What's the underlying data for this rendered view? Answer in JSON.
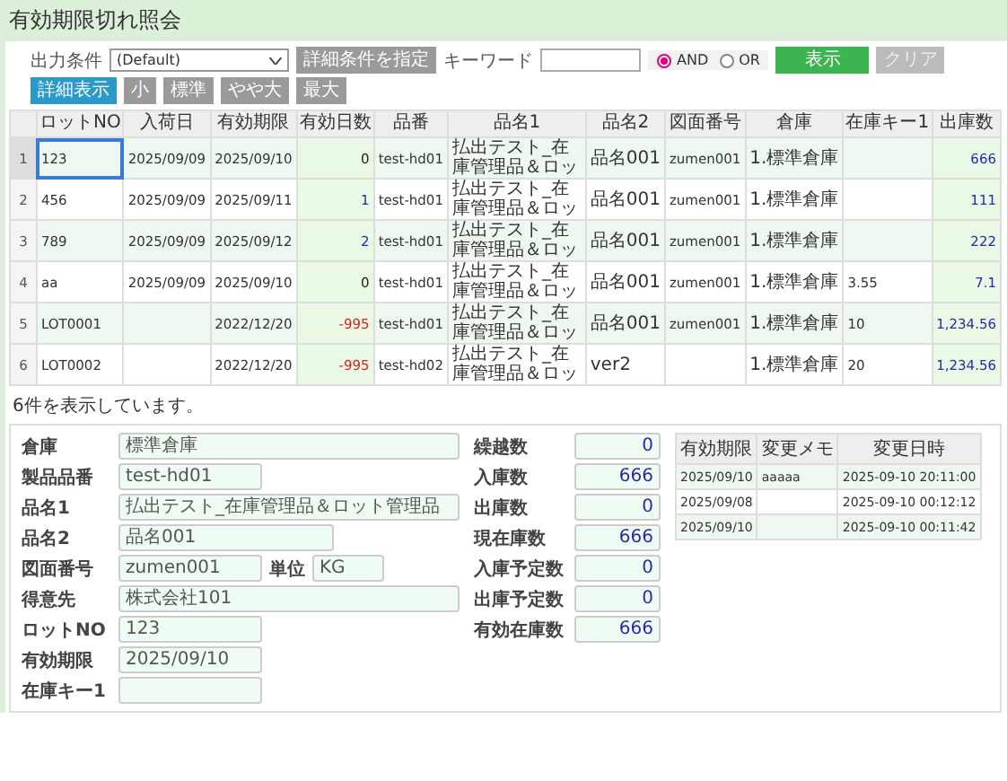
{
  "title": "有効期限切れ照会",
  "toolbar": {
    "output_condition": {
      "label": "出力条件",
      "value": "(Default)"
    },
    "condition_button": "詳細条件を指定",
    "keyword": {
      "label": "キーワード"
    },
    "radios": [
      {
        "label": "AND",
        "selected": true
      },
      {
        "label": "OR",
        "selected": false
      }
    ],
    "buttons": [
      {
        "label": "表示",
        "kind": "primary"
      },
      {
        "label": "クリア",
        "kind": "disabled"
      },
      {
        "label": "詳細表示",
        "kind": "info"
      },
      {
        "label": "小",
        "kind": "size"
      },
      {
        "label": "標準",
        "kind": "size"
      },
      {
        "label": "やや大",
        "kind": "size"
      },
      {
        "label": "最大",
        "kind": "size"
      }
    ]
  },
  "grid": {
    "columns": [
      {
        "label": "ロットNO",
        "kind": "text"
      },
      {
        "label": "入荷日",
        "kind": "text"
      },
      {
        "label": "有効期限",
        "kind": "text"
      },
      {
        "label": "有効日数",
        "kind": "days"
      },
      {
        "label": "品番",
        "kind": "text"
      },
      {
        "label": "品名1",
        "kind": "text"
      },
      {
        "label": "品名2",
        "kind": "text"
      },
      {
        "label": "図面番号",
        "kind": "text"
      },
      {
        "label": "倉庫",
        "kind": "text"
      },
      {
        "label": "在庫キー1",
        "kind": "text"
      },
      {
        "label": "出庫数",
        "kind": "number"
      }
    ],
    "rows": [
      {
        "row_number": "1",
        "selected": true,
        "color": "#222222",
        "cells": [
          "123",
          "2025/09/09",
          "2025/09/10",
          "0",
          "test-hd01",
          "払出テスト_在庫管理品＆ロッ",
          "品名001",
          "zumen001",
          "1.標準倉庫",
          "",
          "666"
        ]
      },
      {
        "row_number": "2",
        "selected": false,
        "color": "#2a2aa8",
        "cells": [
          "456",
          "2025/09/09",
          "2025/09/11",
          "1",
          "test-hd01",
          "払出テスト_在庫管理品＆ロッ",
          "品名001",
          "zumen001",
          "1.標準倉庫",
          "",
          "111"
        ]
      },
      {
        "row_number": "3",
        "selected": false,
        "color": "#2a2aa8",
        "cells": [
          "789",
          "2025/09/09",
          "2025/09/12",
          "2",
          "test-hd01",
          "払出テスト_在庫管理品＆ロッ",
          "品名001",
          "zumen001",
          "1.標準倉庫",
          "",
          "222"
        ]
      },
      {
        "row_number": "4",
        "selected": false,
        "color": "#222222",
        "cells": [
          "aa",
          "2025/09/09",
          "2025/09/10",
          "0",
          "test-hd01",
          "払出テスト_在庫管理品＆ロッ",
          "品名001",
          "zumen001",
          "1.標準倉庫",
          "3.55",
          "7.1"
        ]
      },
      {
        "row_number": "5",
        "selected": false,
        "color": "#e02020",
        "cells": [
          "LOT0001",
          "",
          "2022/12/20",
          "-995",
          "test-hd01",
          "払出テスト_在庫管理品＆ロッ",
          "品名001",
          "zumen001",
          "1.標準倉庫",
          "10",
          "1,234.56"
        ]
      },
      {
        "row_number": "6",
        "selected": false,
        "color": "#e02020",
        "cells": [
          "LOT0002",
          "",
          "2022/12/20",
          "-995",
          "test-hd02",
          "払出テスト_在庫管理品＆ロッ",
          "ver2",
          "",
          "1.標準倉庫",
          "20",
          "1,234.56"
        ]
      }
    ]
  },
  "status": "6件を表示しています。",
  "detail": {
    "fields": [
      {
        "label": "倉庫",
        "value": "標準倉庫",
        "kind": "long"
      },
      {
        "label": "製品品番",
        "value": "test-hd01",
        "kind": "short"
      },
      {
        "label": "品名1",
        "value": "払出テスト_在庫管理品＆ロット管理品",
        "kind": "long"
      },
      {
        "label": "品名2",
        "value": "品名001",
        "kind": "medium"
      },
      {
        "label": "図面番号",
        "value": "zumen001",
        "kind": "short",
        "unit": {
          "label": "単位",
          "value": "KG"
        }
      },
      {
        "label": "得意先",
        "value": "株式会社101",
        "kind": "long"
      },
      {
        "label": "ロットNO",
        "value": "123",
        "kind": "short"
      },
      {
        "label": "有効期限",
        "value": "2025/09/10",
        "kind": "short"
      },
      {
        "label": "在庫キー1",
        "kind": "short"
      }
    ],
    "totals": [
      {
        "label": "繰越数",
        "value": "0"
      },
      {
        "label": "入庫数",
        "value": "666"
      },
      {
        "label": "出庫数",
        "value": "0"
      },
      {
        "label": "現在庫数",
        "value": "666"
      },
      {
        "label": "入庫予定数",
        "value": "0"
      },
      {
        "label": "出庫予定数",
        "value": "0"
      },
      {
        "label": "有効在庫数",
        "value": "666"
      }
    ],
    "history": {
      "columns": [
        "有効期限",
        "変更メモ",
        "変更日時"
      ],
      "rows": [
        {
          "expiry": "2025/09/10",
          "memo": "aaaaa",
          "changed_at": "2025-09-10 20:11:00"
        },
        {
          "expiry": "2025/09/08",
          "changed_at": "2025-09-10 00:12:12"
        },
        {
          "expiry": "2025/09/10",
          "changed_at": "2025-09-10 00:11:42"
        }
      ]
    }
  }
}
